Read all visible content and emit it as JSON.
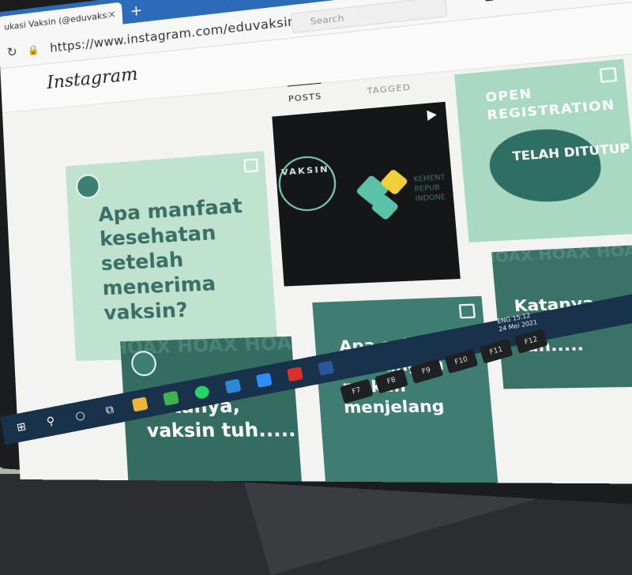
{
  "browser": {
    "tab_title": "ukasi Vaksin (@eduvaksin) • In",
    "close_glyph": "×",
    "new_tab_glyph": "+",
    "url": "https://www.instagram.com/eduvaksin/"
  },
  "instagram": {
    "logo_text": "Instagram",
    "search_placeholder": "Search",
    "tabs": [
      {
        "label": "POSTS",
        "active": true
      },
      {
        "label": "TAGGED",
        "active": false
      }
    ],
    "posts": [
      {
        "text": "Apa manfaat kesehatan setelah menerima vaksin?"
      },
      {
        "text": "VAKSIN",
        "side_text": "KEMENT REPUB INDONE"
      },
      {
        "text_top": "OPEN REGISTRATION",
        "text_center": "TELAH DITUTUP"
      },
      {
        "text": "Katanya, vaksin tuh.....",
        "bg_text": "HOAX HOAX HOAX HO"
      },
      {
        "text": "Apa saja pantangan makan menjelang"
      },
      {
        "text": "Katanya, vaksin tuh.....",
        "bg_text": "HOAX HOAX HOAX"
      }
    ]
  },
  "taskbar": {
    "time": "15.12",
    "date": "24 Mei 2021",
    "lang": "ENG"
  },
  "keyboard": {
    "keys": [
      "F7",
      "F8",
      "F9",
      "F10",
      "F11",
      "F12"
    ]
  },
  "colors": {
    "tab_bar": "#2c6bb8",
    "taskbar": "#18324c",
    "post_mint": "#bfe3cf",
    "post_teal": "#356c62"
  }
}
